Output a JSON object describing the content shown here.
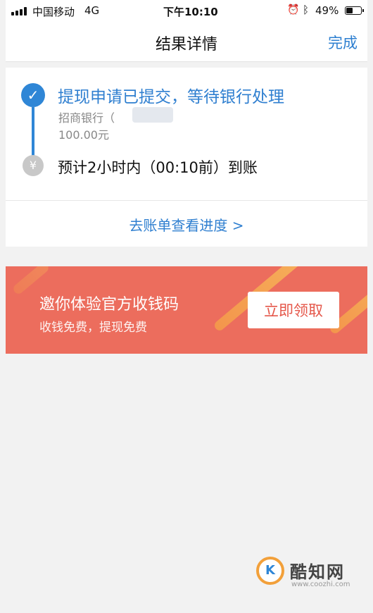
{
  "status_bar": {
    "carrier": "中国移动",
    "network": "4G",
    "time": "下午10:10",
    "battery_percent": "49%",
    "battery_level": 0.49
  },
  "nav": {
    "title": "结果详情",
    "done_label": "完成"
  },
  "result": {
    "step1": {
      "title": "提现申请已提交，等待银行处理",
      "bank": "招商银行（",
      "amount": "100.00元"
    },
    "step2": {
      "icon_glyph": "¥",
      "text": "预计2小时内（00:10前）到账"
    },
    "progress_link": "去账单查看进度 >"
  },
  "banner": {
    "title": "邀你体验官方收钱码",
    "subtitle": "收钱免费，提现免费",
    "button_label": "立即领取"
  },
  "watermark": {
    "logo_text": "K",
    "name": "酷知网",
    "url": "www.coozhi.com"
  },
  "colors": {
    "accent": "#2f7fd0",
    "banner": "#ec6d5d"
  }
}
